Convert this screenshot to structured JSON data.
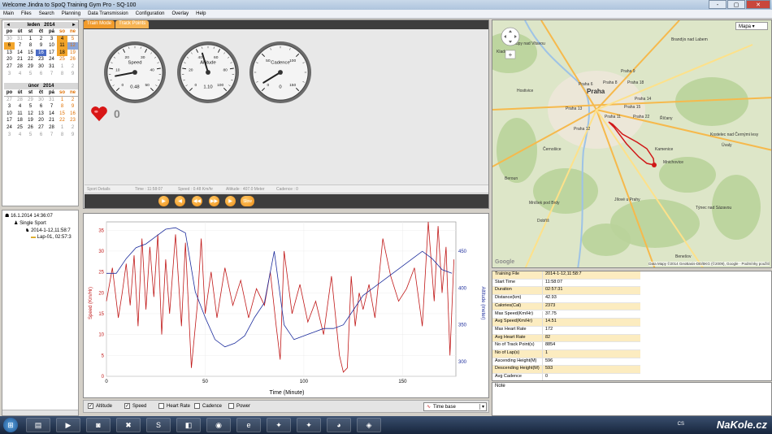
{
  "window": {
    "title": "Welcome Jindra to SpoQ Training Gym Pro - SQ-100",
    "buttons": [
      "-",
      "▢",
      "✕"
    ]
  },
  "menu": [
    "Main",
    "Files",
    "Search",
    "Planning",
    "Data Transmission",
    "Configuration",
    "Overlay",
    "Help"
  ],
  "calendar1": {
    "month": "leden",
    "year": "2014",
    "prev": "◄",
    "next": "►",
    "dow": [
      "po",
      "út",
      "st",
      "čt",
      "pá",
      "so",
      "ne"
    ],
    "rows": [
      [
        "30",
        "31",
        "1",
        "2",
        "3",
        "4",
        "5"
      ],
      [
        "6",
        "7",
        "8",
        "9",
        "10",
        "11",
        "12"
      ],
      [
        "13",
        "14",
        "15",
        "16",
        "17",
        "18",
        "19"
      ],
      [
        "20",
        "21",
        "22",
        "23",
        "24",
        "25",
        "26"
      ],
      [
        "27",
        "28",
        "29",
        "30",
        "31",
        "1",
        "2"
      ],
      [
        "3",
        "4",
        "5",
        "6",
        "7",
        "8",
        "9"
      ]
    ]
  },
  "calendar2": {
    "month": "únor",
    "year": "2014",
    "dow": [
      "po",
      "út",
      "st",
      "čt",
      "pá",
      "so",
      "ne"
    ],
    "rows": [
      [
        "27",
        "28",
        "29",
        "30",
        "31",
        "1",
        "2"
      ],
      [
        "3",
        "4",
        "5",
        "6",
        "7",
        "8",
        "9"
      ],
      [
        "10",
        "11",
        "12",
        "13",
        "14",
        "15",
        "16"
      ],
      [
        "17",
        "18",
        "19",
        "20",
        "21",
        "22",
        "23"
      ],
      [
        "24",
        "25",
        "26",
        "27",
        "28",
        "1",
        "2"
      ],
      [
        "3",
        "4",
        "5",
        "6",
        "7",
        "8",
        "9"
      ]
    ]
  },
  "tree": {
    "root": "16.1.2014 14:36:07",
    "sport": "Single Sport",
    "session": "2014-1-12,11:58:7",
    "lap": "Lap-01, 02:57:3"
  },
  "tabs": [
    "Train Mode",
    "Track Points"
  ],
  "gauges": [
    {
      "label": "Speed",
      "value": "0.48",
      "ticks": [
        "0",
        "10",
        "20",
        "30",
        "40",
        "50"
      ]
    },
    {
      "label": "Altitude",
      "value": "1.10",
      "ticks": [
        "0",
        "20",
        "40",
        "60",
        "80",
        "100"
      ]
    },
    {
      "label": "Cadence",
      "value": "0",
      "ticks": [
        "0",
        "50",
        "100",
        "150"
      ]
    }
  ],
  "heart_rate": "0",
  "status": {
    "sport": "Sport Details",
    "time": "Time : 11:58:07",
    "speed": "Speed : 0.48 Km/hr",
    "altitude": "Altitude : 407.0 Meter",
    "cadence": "Cadence : 0"
  },
  "controls": [
    "▶",
    "◀",
    "◀◀",
    "▶▶",
    "▶",
    "Slow"
  ],
  "chart_data": {
    "type": "line",
    "title": "",
    "xlabel": "Time (Minute)",
    "ylabel": "Speed (Km/Hr)",
    "y2label": "Altitude (meter)",
    "x_ticks": [
      "0",
      "50",
      "100",
      "150"
    ],
    "y_ticks": [
      "0",
      "5",
      "10",
      "15",
      "20",
      "25",
      "30",
      "35"
    ],
    "y2_ticks": [
      "300",
      "350",
      "400",
      "450"
    ],
    "xlim": [
      0,
      177
    ],
    "ylim": [
      0,
      37
    ],
    "y2lim": [
      280,
      490
    ],
    "series": [
      {
        "name": "Speed",
        "color": "#c01818",
        "axis": "left",
        "x": [
          0,
          3,
          6,
          8,
          10,
          12,
          14,
          16,
          18,
          20,
          22,
          24,
          26,
          28,
          30,
          32,
          35,
          38,
          40,
          43,
          46,
          48,
          50,
          53,
          56,
          60,
          64,
          68,
          72,
          76,
          80,
          83,
          86,
          88,
          90,
          94,
          98,
          102,
          106,
          110,
          114,
          118,
          120,
          122,
          124,
          126,
          128,
          130,
          133,
          136,
          140,
          144,
          148,
          152,
          156,
          160,
          163,
          166,
          168,
          170,
          172,
          174,
          176
        ],
        "y": [
          18,
          26,
          14,
          20,
          27,
          17,
          29,
          12,
          33,
          16,
          31,
          19,
          34,
          10,
          28,
          15,
          34,
          12,
          32,
          2,
          17,
          33,
          15,
          25,
          14,
          26,
          17,
          23,
          14,
          21,
          17,
          25,
          12,
          4,
          30,
          15,
          22,
          13,
          18,
          10,
          24,
          5,
          1,
          2,
          24,
          12,
          20,
          16,
          22,
          14,
          33,
          24,
          18,
          21,
          26,
          12,
          37,
          18,
          36,
          20,
          31,
          5,
          28
        ]
      },
      {
        "name": "Altitude",
        "color": "#1c2c9c",
        "axis": "right",
        "x": [
          0,
          5,
          10,
          15,
          20,
          25,
          30,
          35,
          40,
          45,
          50,
          55,
          60,
          65,
          70,
          75,
          80,
          85,
          90,
          95,
          100,
          105,
          110,
          115,
          120,
          125,
          130,
          135,
          140,
          145,
          150,
          155,
          160,
          165,
          170,
          175
        ],
        "y": [
          420,
          420,
          440,
          455,
          460,
          470,
          480,
          482,
          475,
          395,
          360,
          330,
          320,
          325,
          335,
          360,
          380,
          450,
          350,
          330,
          335,
          340,
          345,
          345,
          350,
          370,
          390,
          400,
          410,
          420,
          430,
          440,
          450,
          440,
          425,
          420
        ]
      }
    ]
  },
  "options": [
    {
      "label": "Altitude",
      "checked": "✓"
    },
    {
      "label": "Speed",
      "checked": "✓"
    },
    {
      "label": "Heart Rate",
      "checked": ""
    },
    {
      "label": "Cadence",
      "checked": ""
    },
    {
      "label": "Power",
      "checked": ""
    }
  ],
  "timebase": "Time base",
  "map": {
    "type": "Mapa",
    "google": "Google",
    "copyright": "Data Mapy ©2014 GeoBasis-DE/BKG (©2009), Google",
    "terms": "Podmínky použití",
    "labels": [
      "Praha",
      "Praha 8",
      "Praha 18",
      "Praha 6",
      "Praha 9",
      "Praha 14",
      "Praha 13",
      "Praha 12",
      "Praha 11",
      "Praha 15",
      "Praha 22",
      "Brandýs nad Labem",
      "Kralupy nad Vltavou",
      "Mnichovice",
      "Benešov",
      "Kamenice",
      "Jílové u Prahy",
      "Říčany",
      "Černošice",
      "Dobříš",
      "Hostivice",
      "Beroun",
      "Úvaly",
      "Kostelec nad Černými lesy",
      "Kladno",
      "Týnec nad Sázavou",
      "Mníšek pod Brdy"
    ],
    "colors": {
      "land": "#dde6c8",
      "forest": "#b9d39a",
      "urban": "#ece7d8",
      "water": "#9ec3e6",
      "highway": "#f6b94c",
      "road": "#fde18a",
      "route": "#d01818"
    }
  },
  "stats": [
    [
      "Training File",
      "2014-1-12,11:58:7"
    ],
    [
      "Start Time",
      "11:58:07"
    ],
    [
      "Duration",
      "02:57:31"
    ],
    [
      "Distance(km)",
      "42.93"
    ],
    [
      "Calories(Cal)",
      "2373"
    ],
    [
      "Max Speed(Km/Hr)",
      "37.75"
    ],
    [
      "Avg Speed(Km/Hr)",
      "14.51"
    ],
    [
      "Max Heart Rate",
      "172"
    ],
    [
      "Avg Heart Rate",
      "82"
    ],
    [
      "No of Track Point(s)",
      "8854"
    ],
    [
      "No of Lap(s)",
      "1"
    ],
    [
      "Ascending Height(M)",
      "596"
    ],
    [
      "Descending Height(M)",
      "593"
    ],
    [
      "Avg Cadence",
      "0"
    ]
  ],
  "note_label": "Note",
  "taskbar": {
    "start": "⊞",
    "apps": [
      "▤",
      "▶",
      "◙",
      "✖",
      "S",
      "◧",
      "◉",
      "e",
      "✦",
      "✦",
      "◕",
      "◈"
    ],
    "tray": "CS",
    "watermark": "NaKole.cz"
  }
}
